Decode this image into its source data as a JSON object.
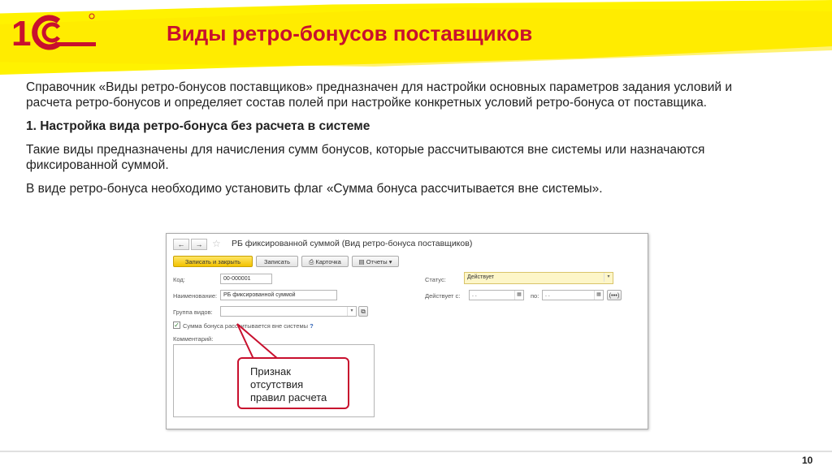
{
  "slide": {
    "title": "Виды ретро-бонусов поставщиков",
    "page_number": "10",
    "brand_colors": {
      "accent_red": "#c8102e",
      "highlight_yellow": "#fff200"
    },
    "logo_icon": "1c-logo-icon"
  },
  "content": {
    "paragraph1": "Справочник «Виды ретро-бонусов поставщиков» предназначен для настройки основных параметров задания условий и расчета ретро-бонусов и определяет состав полей при настройке конкретных условий ретро-бонуса от поставщика.",
    "heading1": "1. Настройка вида ретро-бонуса без расчета в системе",
    "paragraph2": "Такие виды предназначены для начисления сумм бонусов, которые рассчитываются вне системы или назначаются фиксированной суммой.",
    "paragraph3": "В виде ретро-бонуса необходимо установить флаг «Сумма бонуса рассчитывается вне системы»."
  },
  "form": {
    "title": "РБ фиксированной суммой (Вид ретро-бонуса поставщиков)",
    "nav_back": "←",
    "nav_forward": "→",
    "toolbar": {
      "save_close": "Записать и закрыть",
      "save": "Записать",
      "card": "Карточка",
      "reports": "Отчеты"
    },
    "fields": {
      "code_label": "Код:",
      "code_value": "00-000001",
      "name_label": "Наименование:",
      "name_value": "РБ фиксированной суммой",
      "group_label": "Группа видов:",
      "group_value": "",
      "status_label": "Статус:",
      "status_value": "Действует",
      "valid_from_label": "Действует с:",
      "valid_from_value": ". .",
      "valid_to_label": "по:",
      "valid_to_value": ". .",
      "checkbox_label": "Сумма бонуса рассчитывается вне системы",
      "checkbox_checked": true,
      "help_mark": "?",
      "comment_label": "Комментарий:"
    }
  },
  "callout": {
    "line1": "Признак",
    "line2": "отсутствия",
    "line3": "правил расчета"
  }
}
